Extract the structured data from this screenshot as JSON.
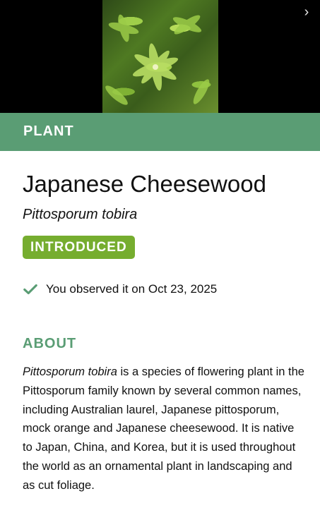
{
  "photo": {
    "alt": ""
  },
  "category": {
    "label": "PLANT"
  },
  "species": {
    "common_name": "Japanese Cheesewood",
    "scientific_name": "Pittosporum tobira",
    "status_badge": "INTRODUCED"
  },
  "observation": {
    "text": "You observed it on Oct 23, 2025"
  },
  "about": {
    "heading": "ABOUT",
    "italic_lead": "Pittosporum tobira",
    "body": " is a species of flowering plant in the Pittosporum family known by several common names, including Australian laurel, Japanese pittosporum, mock orange and Japanese cheesewood. It is native to Japan, China, and Korea, but it is used throughout the world as an ornamental plant in landscaping and as cut foliage."
  },
  "icons": {
    "next": "chevron-right-icon",
    "check": "check-icon"
  },
  "colors": {
    "accent_green": "#5a9d74",
    "badge_green": "#76ad2f",
    "photo_background": "#000000"
  }
}
